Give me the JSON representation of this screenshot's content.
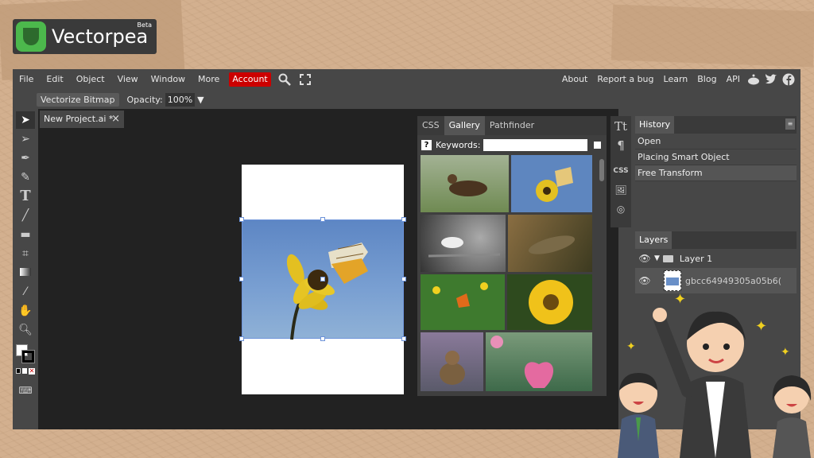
{
  "logo": {
    "name": "Vectorpea",
    "badge": "Beta"
  },
  "menubar": {
    "items": [
      "File",
      "Edit",
      "Object",
      "View",
      "Window",
      "More"
    ],
    "account": "Account",
    "right_items": [
      "About",
      "Report a bug",
      "Learn",
      "Blog",
      "API"
    ]
  },
  "options_bar": {
    "vectorize_label": "Vectorize Bitmap",
    "opacity_label": "Opacity:",
    "opacity_value": "100%"
  },
  "document_tab": {
    "title": "New Project.ai *",
    "close": "×"
  },
  "gallery_panel": {
    "tabs": [
      "CSS",
      "Gallery",
      "Pathfinder"
    ],
    "selected_tab": "Gallery",
    "keywords_label": "Keywords:",
    "help": "?",
    "keywords_value": ""
  },
  "icon_strip": {
    "css_label": "CSS",
    "text_glyph": "Tt",
    "para_glyph": "¶"
  },
  "history_panel": {
    "title": "History",
    "items": [
      "Open",
      "Placing Smart Object",
      "Free Transform"
    ],
    "selected_index": 2
  },
  "layers_panel": {
    "title": "Layers",
    "layers": [
      {
        "name": "Layer 1",
        "type": "folder"
      },
      {
        "name": "gbcc64949305a05b6(",
        "type": "image"
      }
    ]
  },
  "colors": {
    "account": "#cc0000",
    "selection": "#6d93d9",
    "panel": "#474747",
    "workspace": "#222222"
  }
}
